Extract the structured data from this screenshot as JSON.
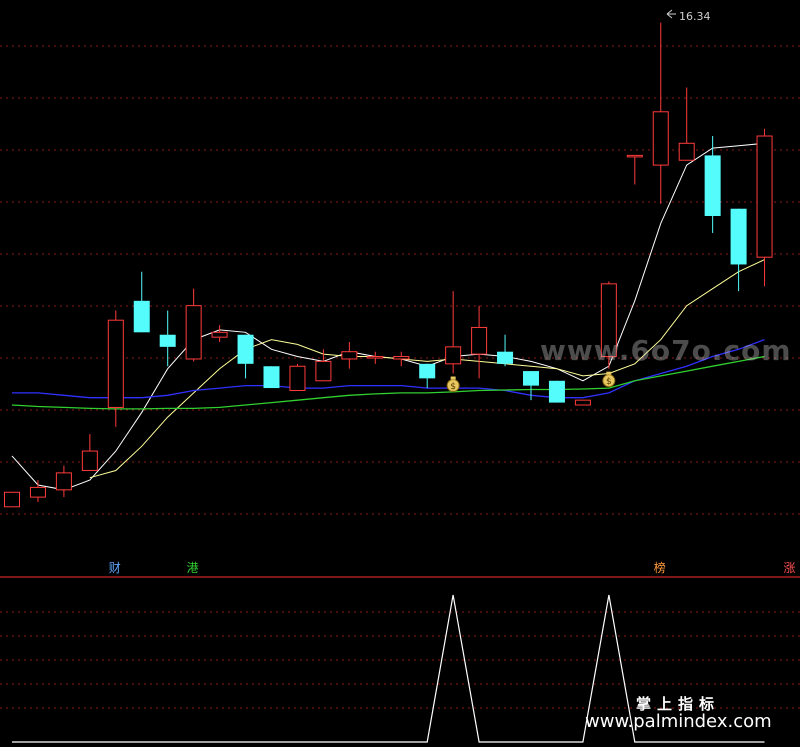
{
  "chart_data": [
    {
      "type": "candlestick",
      "panel": "main",
      "title": "",
      "max_price_label": "16.34",
      "ylim": [
        5.5,
        16.6
      ],
      "grid": true,
      "colors": {
        "up_body_outline": "#ff3b3b",
        "down_body_fill": "#54fcfc",
        "ma_short": "#ffffff",
        "ma_mid": "#ffff99",
        "ma_long": "#3030ff",
        "ma_longest": "#30d030",
        "grid": "#8b1a1a",
        "panel_divider": "#ff3030"
      },
      "candles": [
        {
          "o": 6.35,
          "h": 6.65,
          "l": 6.35,
          "c": 6.65
        },
        {
          "o": 6.55,
          "h": 6.9,
          "l": 6.45,
          "c": 6.75
        },
        {
          "o": 6.7,
          "h": 7.2,
          "l": 6.55,
          "c": 7.05
        },
        {
          "o": 7.1,
          "h": 7.85,
          "l": 7.1,
          "c": 7.5
        },
        {
          "o": 8.4,
          "h": 10.4,
          "l": 8.0,
          "c": 10.2
        },
        {
          "o": 10.6,
          "h": 11.2,
          "l": 10.1,
          "c": 9.95
        },
        {
          "o": 9.9,
          "h": 10.4,
          "l": 9.25,
          "c": 9.65
        },
        {
          "o": 9.4,
          "h": 10.85,
          "l": 9.35,
          "c": 10.5
        },
        {
          "o": 9.85,
          "h": 10.1,
          "l": 9.75,
          "c": 9.95
        },
        {
          "o": 9.9,
          "h": 9.9,
          "l": 9.0,
          "c": 9.3
        },
        {
          "o": 9.25,
          "h": 9.25,
          "l": 8.8,
          "c": 8.8
        },
        {
          "o": 8.75,
          "h": 9.3,
          "l": 8.75,
          "c": 9.25
        },
        {
          "o": 8.95,
          "h": 9.6,
          "l": 8.95,
          "c": 9.35
        },
        {
          "o": 9.4,
          "h": 9.75,
          "l": 9.2,
          "c": 9.55
        },
        {
          "o": 9.45,
          "h": 9.55,
          "l": 9.3,
          "c": 9.45
        },
        {
          "o": 9.4,
          "h": 9.55,
          "l": 9.25,
          "c": 9.45
        },
        {
          "o": 9.3,
          "h": 9.3,
          "l": 8.8,
          "c": 9.0
        },
        {
          "o": 9.3,
          "h": 10.8,
          "l": 9.1,
          "c": 9.65
        },
        {
          "o": 9.5,
          "h": 10.5,
          "l": 9.0,
          "c": 10.05
        },
        {
          "o": 9.55,
          "h": 9.9,
          "l": 9.25,
          "c": 9.3
        },
        {
          "o": 9.15,
          "h": 9.15,
          "l": 8.55,
          "c": 8.85
        },
        {
          "o": 8.95,
          "h": 8.95,
          "l": 8.5,
          "c": 8.5
        },
        {
          "o": 8.45,
          "h": 8.55,
          "l": 8.45,
          "c": 8.55
        },
        {
          "o": 9.45,
          "h": 11.0,
          "l": 9.2,
          "c": 10.95
        },
        {
          "o": 13.6,
          "h": 13.6,
          "l": 13.0,
          "c": 13.6
        },
        {
          "o": 13.4,
          "h": 16.34,
          "l": 12.6,
          "c": 14.5
        },
        {
          "o": 13.5,
          "h": 15.0,
          "l": 13.5,
          "c": 13.85
        },
        {
          "o": 13.6,
          "h": 14.0,
          "l": 12.0,
          "c": 12.35
        },
        {
          "o": 12.5,
          "h": 12.5,
          "l": 10.8,
          "c": 11.35
        },
        {
          "o": 11.5,
          "h": 14.15,
          "l": 10.9,
          "c": 14.0
        }
      ],
      "series": [
        {
          "values": [
            7.4,
            6.8,
            6.7,
            6.9,
            7.5,
            8.3,
            9.2,
            9.8,
            10.0,
            9.95,
            9.6,
            9.45,
            9.35,
            9.55,
            9.45,
            9.4,
            9.25,
            9.45,
            9.5,
            9.45,
            9.35,
            9.2,
            8.95,
            9.25,
            10.6,
            12.2,
            13.4,
            13.75,
            13.8,
            13.85
          ]
        },
        {
          "values": [
            null,
            null,
            null,
            6.95,
            7.1,
            7.6,
            8.2,
            8.7,
            9.2,
            9.6,
            9.8,
            9.7,
            9.5,
            9.45,
            9.45,
            9.4,
            9.35,
            9.4,
            9.35,
            9.3,
            9.25,
            9.2,
            9.05,
            9.1,
            9.3,
            9.8,
            10.5,
            10.85,
            11.2,
            11.45
          ]
        },
        {
          "values": [
            8.7,
            8.7,
            8.65,
            8.6,
            8.6,
            8.6,
            8.65,
            8.75,
            8.8,
            8.85,
            8.85,
            8.8,
            8.8,
            8.85,
            8.85,
            8.85,
            8.8,
            8.8,
            8.8,
            8.75,
            8.65,
            8.6,
            8.6,
            8.7,
            8.95,
            9.1,
            9.25,
            9.45,
            9.6,
            9.8
          ]
        },
        {
          "values": [
            8.45,
            8.42,
            8.4,
            8.38,
            8.37,
            8.37,
            8.38,
            8.38,
            8.4,
            8.45,
            8.5,
            8.55,
            8.6,
            8.65,
            8.68,
            8.7,
            8.7,
            8.72,
            8.75,
            8.76,
            8.77,
            8.77,
            8.78,
            8.8,
            8.95,
            9.05,
            9.15,
            9.25,
            9.35,
            9.45
          ]
        }
      ],
      "markers": [
        {
          "index": 17,
          "symbol": "money-bag"
        },
        {
          "index": 23,
          "symbol": "money-bag"
        }
      ],
      "tags": [
        {
          "index": 4,
          "text": "财",
          "color": "#5fa8ff"
        },
        {
          "index": 7,
          "text": "港",
          "color": "#30d030"
        },
        {
          "index": 25,
          "text": "榜",
          "color": "#ff9a3c"
        },
        {
          "index": 30,
          "text": "涨",
          "color": "#ff5050"
        }
      ]
    },
    {
      "type": "line",
      "panel": "indicator",
      "title": "",
      "ylim": [
        0,
        1
      ],
      "grid": true,
      "series": [
        {
          "color": "#ffffff",
          "values": [
            0,
            0,
            0,
            0,
            0,
            0,
            0,
            0,
            0,
            0,
            0,
            0,
            0,
            0,
            0,
            0,
            0,
            1,
            0,
            0,
            0,
            0,
            0,
            1,
            0,
            0,
            0,
            0,
            0,
            0
          ]
        }
      ]
    }
  ],
  "watermarks": {
    "middle": "www.6o7o.com",
    "bottom_title": "掌上指标",
    "bottom_url": "www.palmindex.com"
  }
}
